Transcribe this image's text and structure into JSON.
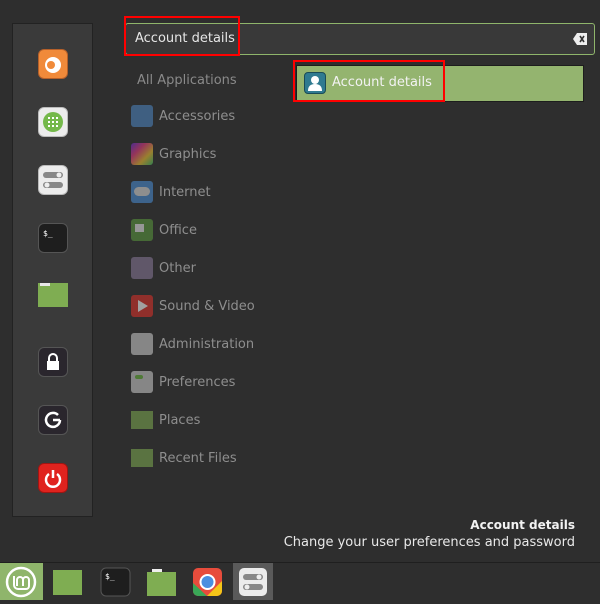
{
  "search": {
    "value": "Account details",
    "clear_icon": "backspace-clear-icon"
  },
  "favorites": [
    {
      "name": "firefox",
      "icon": "firefox-icon"
    },
    {
      "name": "software-manager",
      "icon": "grid-apps-icon"
    },
    {
      "name": "system-settings",
      "icon": "toggles-icon"
    },
    {
      "name": "terminal",
      "icon": "terminal-icon"
    },
    {
      "name": "files",
      "icon": "folder-icon"
    },
    {
      "name": "lock-screen",
      "icon": "lock-icon"
    },
    {
      "name": "logout",
      "icon": "logout-icon"
    },
    {
      "name": "shutdown",
      "icon": "power-icon"
    }
  ],
  "categories": {
    "all": "All Applications",
    "items": [
      {
        "label": "Accessories",
        "icon": "scissors-icon"
      },
      {
        "label": "Graphics",
        "icon": "color-palette-icon"
      },
      {
        "label": "Internet",
        "icon": "cloud-icon"
      },
      {
        "label": "Office",
        "icon": "document-icon"
      },
      {
        "label": "Other",
        "icon": "grid-icon"
      },
      {
        "label": "Sound & Video",
        "icon": "play-icon"
      },
      {
        "label": "Administration",
        "icon": "toggles-icon"
      },
      {
        "label": "Preferences",
        "icon": "toggles-green-icon"
      },
      {
        "label": "Places",
        "icon": "folder-icon"
      },
      {
        "label": "Recent Files",
        "icon": "recent-folder-icon"
      }
    ]
  },
  "results": [
    {
      "label": "Account details",
      "icon": "user-account-icon"
    }
  ],
  "info": {
    "title": "Account details",
    "description": "Change your user preferences and password"
  },
  "panel": {
    "items": [
      {
        "name": "menu",
        "icon": "mint-logo-icon"
      },
      {
        "name": "show-desktop",
        "icon": "desktop-icon"
      },
      {
        "name": "terminal",
        "icon": "terminal-icon"
      },
      {
        "name": "files",
        "icon": "folder-icon"
      },
      {
        "name": "chrome",
        "icon": "chrome-icon"
      },
      {
        "name": "system-settings",
        "icon": "toggles-icon"
      }
    ]
  },
  "colors": {
    "accent": "#8fb56b",
    "result_bg": "#94b46f",
    "highlight_box": "#ff0000"
  }
}
